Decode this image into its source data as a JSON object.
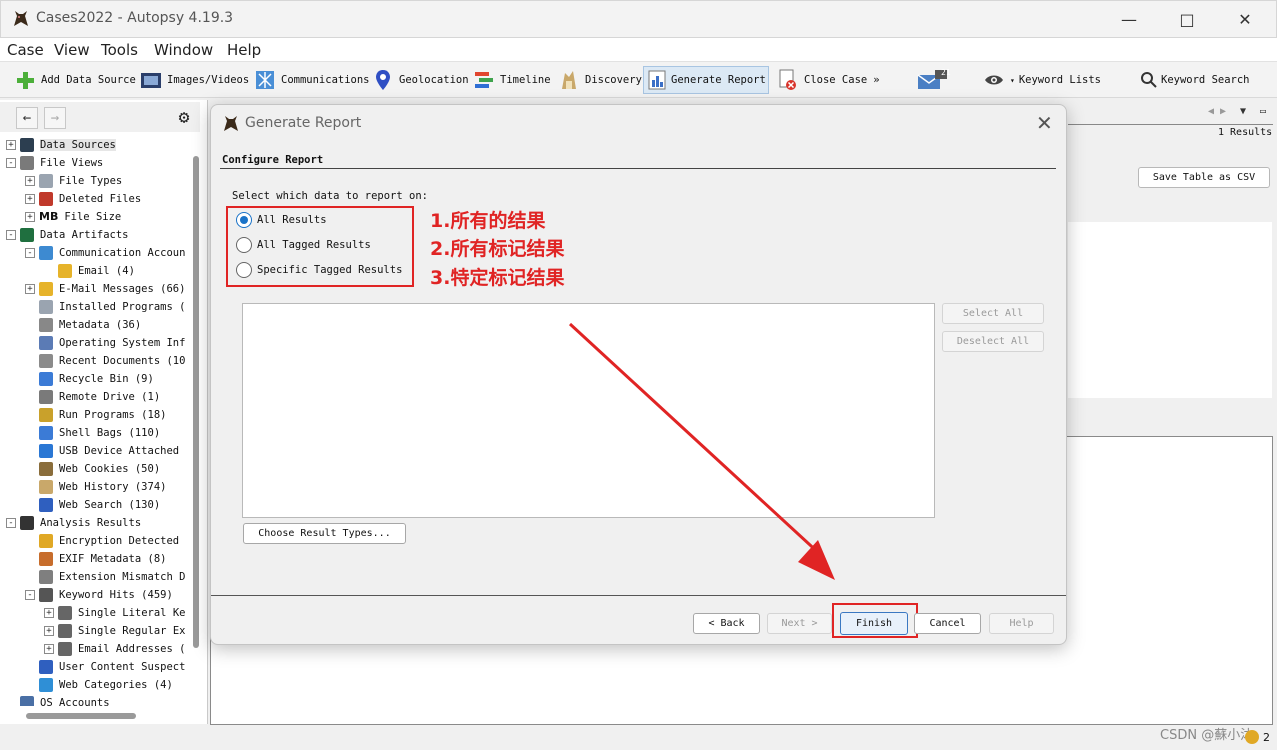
{
  "window": {
    "title": "Cases2022 - Autopsy 4.19.3",
    "min": "—",
    "max": "□",
    "close": "✕"
  },
  "menu": [
    "Case",
    "View",
    "Tools",
    "Window",
    "Help"
  ],
  "toolbar": {
    "add_data_source": "Add Data Source",
    "images_videos": "Images/Videos",
    "communications": "Communications",
    "geolocation": "Geolocation",
    "timeline": "Timeline",
    "discovery": "Discovery",
    "generate_report": "Generate Report",
    "close_case": "Close Case",
    "mail_badge": "21",
    "keyword_lists": "Keyword Lists",
    "keyword_search": "Keyword Search"
  },
  "tree": [
    {
      "label": "Data Sources",
      "lvl": 0,
      "toggle": "+",
      "selected": true
    },
    {
      "label": "File Views",
      "lvl": 0,
      "toggle": "-"
    },
    {
      "label": "File Types",
      "lvl": 1,
      "toggle": "+"
    },
    {
      "label": "Deleted Files",
      "lvl": 1,
      "toggle": "+"
    },
    {
      "label": "File Size",
      "lvl": 1,
      "toggle": "+",
      "prefix": "MB"
    },
    {
      "label": "Data Artifacts",
      "lvl": 0,
      "toggle": "-"
    },
    {
      "label": "Communication Accoun",
      "lvl": 1,
      "toggle": "-"
    },
    {
      "label": "Email (4)",
      "lvl": 2,
      "toggle": ""
    },
    {
      "label": "E-Mail Messages (66)",
      "lvl": 1,
      "toggle": "+"
    },
    {
      "label": "Installed Programs (",
      "lvl": 1,
      "toggle": ""
    },
    {
      "label": "Metadata (36)",
      "lvl": 1,
      "toggle": ""
    },
    {
      "label": "Operating System Inf",
      "lvl": 1,
      "toggle": ""
    },
    {
      "label": "Recent Documents (10",
      "lvl": 1,
      "toggle": ""
    },
    {
      "label": "Recycle Bin (9)",
      "lvl": 1,
      "toggle": ""
    },
    {
      "label": "Remote Drive (1)",
      "lvl": 1,
      "toggle": ""
    },
    {
      "label": "Run Programs (18)",
      "lvl": 1,
      "toggle": ""
    },
    {
      "label": "Shell Bags (110)",
      "lvl": 1,
      "toggle": ""
    },
    {
      "label": "USB Device Attached",
      "lvl": 1,
      "toggle": ""
    },
    {
      "label": "Web Cookies (50)",
      "lvl": 1,
      "toggle": ""
    },
    {
      "label": "Web History (374)",
      "lvl": 1,
      "toggle": ""
    },
    {
      "label": "Web Search (130)",
      "lvl": 1,
      "toggle": ""
    },
    {
      "label": "Analysis Results",
      "lvl": 0,
      "toggle": "-"
    },
    {
      "label": "Encryption Detected",
      "lvl": 1,
      "toggle": ""
    },
    {
      "label": "EXIF Metadata (8)",
      "lvl": 1,
      "toggle": ""
    },
    {
      "label": "Extension Mismatch D",
      "lvl": 1,
      "toggle": ""
    },
    {
      "label": "Keyword Hits (459)",
      "lvl": 1,
      "toggle": "-"
    },
    {
      "label": "Single Literal Ke",
      "lvl": 2,
      "toggle": "+"
    },
    {
      "label": "Single Regular Ex",
      "lvl": 2,
      "toggle": "+"
    },
    {
      "label": "Email Addresses (",
      "lvl": 2,
      "toggle": "+"
    },
    {
      "label": "User Content Suspect",
      "lvl": 1,
      "toggle": ""
    },
    {
      "label": "Web Categories (4)",
      "lvl": 1,
      "toggle": ""
    },
    {
      "label": "OS Accounts",
      "lvl": 0,
      "toggle": ""
    }
  ],
  "right": {
    "results_count": "1 Results",
    "save_csv": "Save Table as CSV"
  },
  "dialog": {
    "title": "Generate Report",
    "section": "Configure Report",
    "select_label": "Select which data to report on:",
    "options": [
      {
        "label": "All Results",
        "selected": true
      },
      {
        "label": "All Tagged Results",
        "selected": false
      },
      {
        "label": "Specific Tagged Results",
        "selected": false
      }
    ],
    "annotations": [
      "1.所有的结果",
      "2.所有标记结果",
      "3.特定标记结果"
    ],
    "select_all": "Select All",
    "deselect_all": "Deselect All",
    "choose_types": "Choose Result Types...",
    "back": "< Back",
    "next": "Next >",
    "finish": "Finish",
    "cancel": "Cancel",
    "help": "Help"
  },
  "watermark": "CSDN @蘇小沐",
  "status_count": "2"
}
